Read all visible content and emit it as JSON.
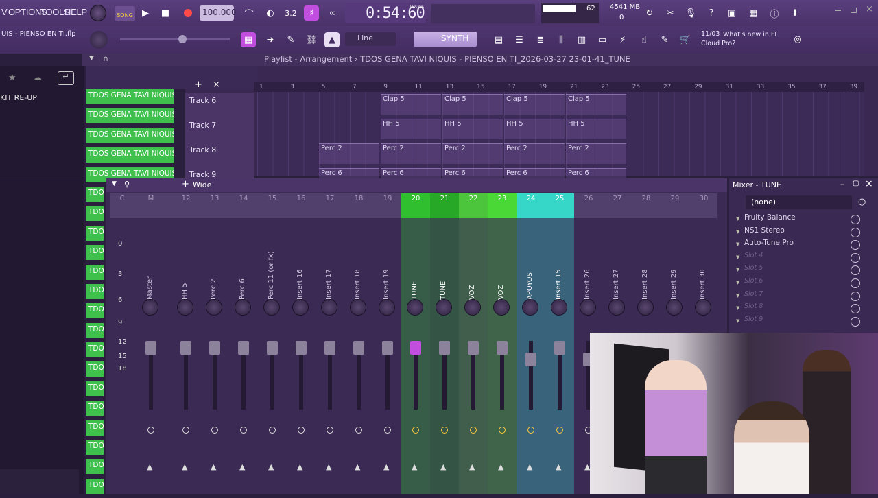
{
  "menu": [
    "V",
    "OPTIONS",
    "TOOLS",
    "HELP"
  ],
  "pattern_mode": "SONG",
  "tempo": "100.000",
  "time": "0:54:60",
  "time_unit": "M:S:CS",
  "cpu": "62",
  "memory": "4541 MB",
  "polyphony": "0",
  "project_file": "UIS - PIENSO EN TI.flp",
  "snap": "Line",
  "preset": "SYNTH",
  "news": {
    "date": "11/03",
    "text": "What's new in FL Cloud Pro?"
  },
  "browser_item": "KIT RE-UP",
  "playlist_title": "Playlist - Arrangement › TDOS GENA TAVI NIQUIS - PIENSO EN TI_2026-03-27 23-01-41_TUNE",
  "ruler": [
    "1",
    "3",
    "5",
    "7",
    "9",
    "11",
    "13",
    "15",
    "17",
    "19",
    "21",
    "23",
    "25",
    "27",
    "29",
    "31",
    "33",
    "35",
    "37",
    "39"
  ],
  "tracks": [
    {
      "name": "Track 6",
      "clips": [
        "Clap 5",
        "Clap 5",
        "Clap 5",
        "Clap 5"
      ]
    },
    {
      "name": "Track 7",
      "clips": [
        "HH 5",
        "HH 5",
        "HH 5",
        "HH 5"
      ]
    },
    {
      "name": "Track 8",
      "clips": [
        "Perc 2",
        "Perc 2",
        "Perc 2",
        "Perc 2",
        "Perc 2"
      ]
    },
    {
      "name": "Track 9",
      "clips": [
        "Perc 6",
        "Perc 6",
        "Perc 6",
        "Perc 6",
        "Perc 6"
      ]
    }
  ],
  "pattern_label": "TDOS GENA TAVI NIQUIS - ...",
  "pattern_short": "TDOS",
  "mixer_view": "Wide",
  "mixer_scale": [
    "0",
    "3",
    "6",
    "9",
    "12",
    "15",
    "18"
  ],
  "strips": [
    {
      "num": "C",
      "name": "",
      "color": ""
    },
    {
      "num": "M",
      "name": "Master",
      "color": ""
    },
    {
      "num": "12",
      "name": "HH 5",
      "color": ""
    },
    {
      "num": "13",
      "name": "Perc 2",
      "color": ""
    },
    {
      "num": "14",
      "name": "Perc 6",
      "color": ""
    },
    {
      "num": "15",
      "name": "Perc 11 (or fx)",
      "color": ""
    },
    {
      "num": "16",
      "name": "Insert 16",
      "color": ""
    },
    {
      "num": "17",
      "name": "Insert 17",
      "color": ""
    },
    {
      "num": "18",
      "name": "Insert 18",
      "color": ""
    },
    {
      "num": "19",
      "name": "Insert 19",
      "color": ""
    },
    {
      "num": "20",
      "name": "TUNE",
      "color": "#2fbf2f"
    },
    {
      "num": "21",
      "name": "TUNE",
      "color": "#27a827"
    },
    {
      "num": "22",
      "name": "VOZ",
      "color": "#4cc53c"
    },
    {
      "num": "23",
      "name": "VOZ",
      "color": "#49d836"
    },
    {
      "num": "24",
      "name": "APOYOS",
      "color": "#36d6c8"
    },
    {
      "num": "25",
      "name": "Insert 15",
      "color": "#36d6c8"
    },
    {
      "num": "26",
      "name": "Insert 26",
      "color": ""
    },
    {
      "num": "27",
      "name": "Insert 27",
      "color": ""
    },
    {
      "num": "28",
      "name": "Insert 28",
      "color": ""
    },
    {
      "num": "29",
      "name": "Insert 29",
      "color": ""
    },
    {
      "num": "30",
      "name": "Insert 30",
      "color": ""
    }
  ],
  "mixer_panel": {
    "title": "Mixer - TUNE",
    "input": "(none)",
    "slots": [
      "Fruity Balance",
      "NS1 Stereo",
      "Auto-Tune Pro",
      "Slot 4",
      "Slot 5",
      "Slot 6",
      "Slot 7",
      "Slot 8",
      "Slot 9"
    ]
  }
}
